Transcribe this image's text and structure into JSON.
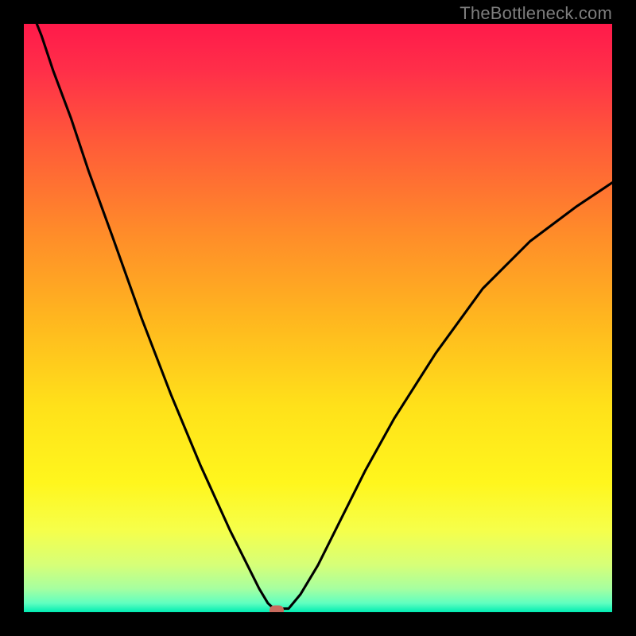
{
  "attribution": "TheBottleneck.com",
  "chart_data": {
    "type": "line",
    "title": "",
    "xlabel": "",
    "ylabel": "",
    "xlim": [
      0,
      100
    ],
    "ylim": [
      0,
      100
    ],
    "background_gradient_stops": [
      {
        "offset": 0.0,
        "color": "#ff1a4a"
      },
      {
        "offset": 0.08,
        "color": "#ff2f49"
      },
      {
        "offset": 0.2,
        "color": "#ff5a39"
      },
      {
        "offset": 0.35,
        "color": "#ff8a2a"
      },
      {
        "offset": 0.5,
        "color": "#ffb61f"
      },
      {
        "offset": 0.65,
        "color": "#ffe11a"
      },
      {
        "offset": 0.78,
        "color": "#fff61d"
      },
      {
        "offset": 0.86,
        "color": "#f6ff4a"
      },
      {
        "offset": 0.92,
        "color": "#d6ff78"
      },
      {
        "offset": 0.96,
        "color": "#a6ffa0"
      },
      {
        "offset": 0.985,
        "color": "#5fffc0"
      },
      {
        "offset": 1.0,
        "color": "#00ecb2"
      }
    ],
    "series": [
      {
        "name": "curve",
        "x": [
          0.0,
          1.0,
          3.0,
          5.0,
          8.0,
          11.0,
          15.0,
          20.0,
          25.0,
          30.0,
          35.0,
          38.0,
          40.0,
          41.5,
          42.5,
          43.5,
          45.0,
          47.0,
          50.0,
          54.0,
          58.0,
          63.0,
          70.0,
          78.0,
          86.0,
          94.0,
          100.0
        ],
        "y": [
          105.0,
          103.0,
          98.0,
          92.0,
          84.0,
          75.0,
          64.0,
          50.0,
          37.0,
          25.0,
          14.0,
          8.0,
          4.0,
          1.5,
          0.6,
          0.6,
          0.6,
          3.0,
          8.0,
          16.0,
          24.0,
          33.0,
          44.0,
          55.0,
          63.0,
          69.0,
          73.0
        ]
      }
    ],
    "reference_point": {
      "x": 43.0,
      "y": 0.3,
      "color": "#c86b5e"
    },
    "annotations": []
  }
}
